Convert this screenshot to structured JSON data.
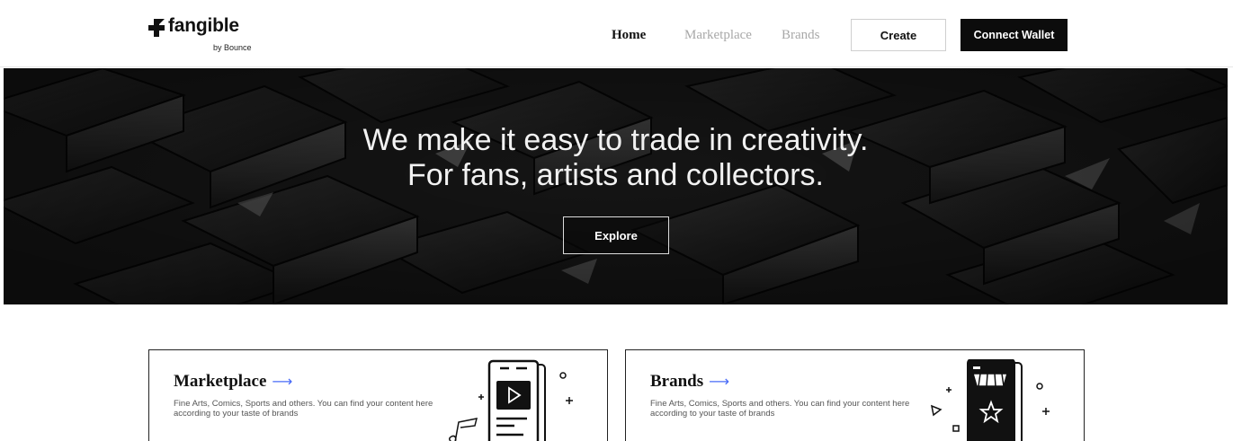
{
  "header": {
    "logo_text": "fangible",
    "logo_sub": "by Bounce",
    "nav": {
      "home": "Home",
      "marketplace": "Marketplace",
      "brands": "Brands"
    },
    "create_label": "Create",
    "connect_label": "Connect Wallet"
  },
  "hero": {
    "line1": "We make it easy to trade in creativity.",
    "line2": "For fans, artists and collectors.",
    "explore_label": "Explore"
  },
  "cards": [
    {
      "title": "Marketplace",
      "arrow": "⟶",
      "description": "Fine Arts, Comics, Sports and others. You can find your content here according to your taste of brands"
    },
    {
      "title": "Brands",
      "arrow": "⟶",
      "description": "Fine Arts, Comics, Sports and others. You can find your content here according to your taste of brands"
    }
  ],
  "colors": {
    "accent": "#4a6cf7",
    "dark": "#0c0c0c",
    "nav_muted": "#a8a8a8"
  }
}
